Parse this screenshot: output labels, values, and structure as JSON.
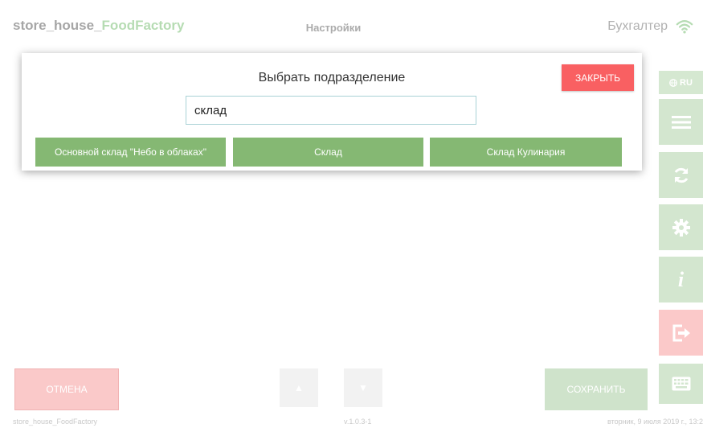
{
  "header": {
    "app_name_prefix": "store_house_",
    "app_name_accent": "FoodFactory",
    "page_title": "Настройки",
    "user_role": "Бухгалтер",
    "wifi_icon": "wifi-icon"
  },
  "sidebar": {
    "language": "RU",
    "buttons": [
      {
        "name": "menu-icon"
      },
      {
        "name": "sync-icon"
      },
      {
        "name": "settings-gear-icon"
      },
      {
        "name": "info-icon"
      },
      {
        "name": "logout-icon"
      },
      {
        "name": "keyboard-icon"
      }
    ]
  },
  "modal": {
    "title": "Выбрать подразделение",
    "close_label": "ЗАКРЫТЬ",
    "search_value": "склад",
    "results": [
      "Основной склад \"Небо в облаках\"",
      "Склад",
      "Склад Кулинария"
    ]
  },
  "footer": {
    "cancel_label": "ОТМЕНА",
    "save_label": "СОХРАНИТЬ"
  },
  "status_bar": {
    "app": "store_house_FoodFactory",
    "version": "v.1.0.3-1",
    "datetime": "вторник, 9 июля 2019 г., 13:2"
  },
  "colors": {
    "accent_green": "#85b873",
    "close_red": "#f96062",
    "cancel_pink": "#fac9c9"
  }
}
